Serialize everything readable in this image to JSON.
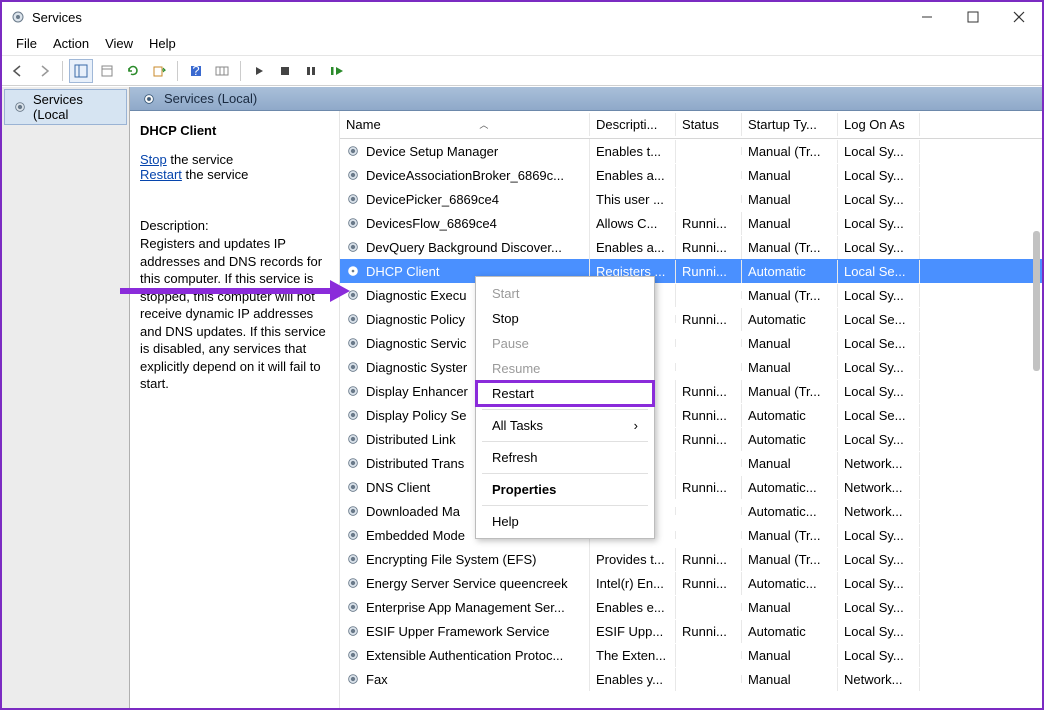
{
  "window": {
    "title": "Services"
  },
  "menu": {
    "file": "File",
    "action": "Action",
    "view": "View",
    "help": "Help"
  },
  "tree": {
    "root": "Services (Local"
  },
  "detail_header": "Services (Local)",
  "svc_pane": {
    "title": "DHCP Client",
    "stop_link": "Stop",
    "stop_suffix": " the service",
    "restart_link": "Restart",
    "restart_suffix": " the service",
    "desc_label": "Description:",
    "desc_text": "Registers and updates IP addresses and DNS records for this computer. If this service is stopped, this computer will not receive dynamic IP addresses and DNS updates. If this service is disabled, any services that explicitly depend on it will fail to start."
  },
  "columns": {
    "name": "Name",
    "desc": "Descripti...",
    "status": "Status",
    "startup": "Startup Ty...",
    "logon": "Log On As"
  },
  "rows": [
    {
      "name": "Device Setup Manager",
      "desc": "Enables t...",
      "status": "",
      "startup": "Manual (Tr...",
      "logon": "Local Sy..."
    },
    {
      "name": "DeviceAssociationBroker_6869c...",
      "desc": "Enables a...",
      "status": "",
      "startup": "Manual",
      "logon": "Local Sy..."
    },
    {
      "name": "DevicePicker_6869ce4",
      "desc": "This user ...",
      "status": "",
      "startup": "Manual",
      "logon": "Local Sy..."
    },
    {
      "name": "DevicesFlow_6869ce4",
      "desc": "Allows C...",
      "status": "Runni...",
      "startup": "Manual",
      "logon": "Local Sy..."
    },
    {
      "name": "DevQuery Background Discover...",
      "desc": "Enables a...",
      "status": "Runni...",
      "startup": "Manual (Tr...",
      "logon": "Local Sy..."
    },
    {
      "name": "DHCP Client",
      "desc": "Registers ...",
      "status": "Runni...",
      "startup": "Automatic",
      "logon": "Local Se..."
    },
    {
      "name": "Diagnostic Execu",
      "desc": "...",
      "status": "",
      "startup": "Manual (Tr...",
      "logon": "Local Sy..."
    },
    {
      "name": "Diagnostic Policy",
      "desc": "",
      "status": "Runni...",
      "startup": "Automatic",
      "logon": "Local Se..."
    },
    {
      "name": "Diagnostic Servic",
      "desc": "",
      "status": "",
      "startup": "Manual",
      "logon": "Local Se..."
    },
    {
      "name": "Diagnostic Syster",
      "desc": "",
      "status": "",
      "startup": "Manual",
      "logon": "Local Sy..."
    },
    {
      "name": "Display Enhancer",
      "desc": "...",
      "status": "Runni...",
      "startup": "Manual (Tr...",
      "logon": "Local Sy..."
    },
    {
      "name": "Display Policy Se",
      "desc": "...",
      "status": "Runni...",
      "startup": "Automatic",
      "logon": "Local Se..."
    },
    {
      "name": "Distributed Link",
      "desc": "...",
      "status": "Runni...",
      "startup": "Automatic",
      "logon": "Local Sy..."
    },
    {
      "name": "Distributed Trans",
      "desc": "...",
      "status": "",
      "startup": "Manual",
      "logon": "Network..."
    },
    {
      "name": "DNS Client",
      "desc": "...",
      "status": "Runni...",
      "startup": "Automatic...",
      "logon": "Network..."
    },
    {
      "name": "Downloaded Ma",
      "desc": "",
      "status": "",
      "startup": "Automatic...",
      "logon": "Network..."
    },
    {
      "name": "Embedded Mode",
      "desc": "",
      "status": "",
      "startup": "Manual (Tr...",
      "logon": "Local Sy..."
    },
    {
      "name": "Encrypting File System (EFS)",
      "desc": "Provides t...",
      "status": "Runni...",
      "startup": "Manual (Tr...",
      "logon": "Local Sy..."
    },
    {
      "name": "Energy Server Service queencreek",
      "desc": "Intel(r) En...",
      "status": "Runni...",
      "startup": "Automatic...",
      "logon": "Local Sy..."
    },
    {
      "name": "Enterprise App Management Ser...",
      "desc": "Enables e...",
      "status": "",
      "startup": "Manual",
      "logon": "Local Sy..."
    },
    {
      "name": "ESIF Upper Framework Service",
      "desc": "ESIF Upp...",
      "status": "Runni...",
      "startup": "Automatic",
      "logon": "Local Sy..."
    },
    {
      "name": "Extensible Authentication Protoc...",
      "desc": "The Exten...",
      "status": "",
      "startup": "Manual",
      "logon": "Local Sy..."
    },
    {
      "name": "Fax",
      "desc": "Enables y...",
      "status": "",
      "startup": "Manual",
      "logon": "Network..."
    }
  ],
  "ctx": {
    "start": "Start",
    "stop": "Stop",
    "pause": "Pause",
    "resume": "Resume",
    "restart": "Restart",
    "alltasks": "All Tasks",
    "refresh": "Refresh",
    "properties": "Properties",
    "help": "Help"
  }
}
